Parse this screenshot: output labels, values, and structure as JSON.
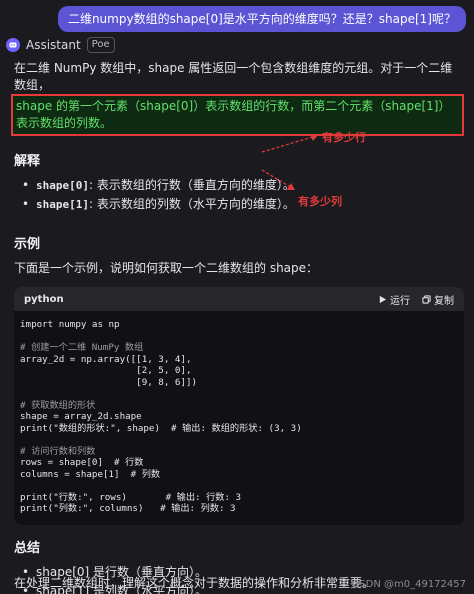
{
  "user_message": "二维numpy数组的shape[0]是水平方向的维度吗？还是？shape[1]呢？",
  "assistant": {
    "name": "Assistant",
    "badge": "Poe"
  },
  "intro_text": "在二维 NumPy 数组中，shape 属性返回一个包含数组维度的元组。对于一个二维数组，",
  "highlight_text": "shape 的第一个元素（shape[0]）表示数组的行数，而第二个元素（shape[1]）表示数组的列数。",
  "section1": {
    "title": "解释",
    "items": [
      {
        "code": "shape[0]",
        "text": ": 表示数组的行数（垂直方向的维度）。"
      },
      {
        "code": "shape[1]",
        "text": ": 表示数组的列数（水平方向的维度）。"
      }
    ]
  },
  "annotations": {
    "rows": "有多少行",
    "cols": "有多少列",
    "color": "#e23a3a"
  },
  "section2": {
    "title": "示例",
    "desc": "下面是一个示例，说明如何获取一个二维数组的 shape："
  },
  "code": {
    "lang": "python",
    "run_label": "运行",
    "copy_label": "复制",
    "lines": [
      "import numpy as np",
      "",
      "# 创建一个二维 NumPy 数组",
      "array_2d = np.array([[1, 3, 4],",
      "                     [2, 5, 0],",
      "                     [9, 8, 6]])",
      "",
      "# 获取数组的形状",
      "shape = array_2d.shape",
      "print(\"数组的形状:\", shape)  # 输出: 数组的形状: (3, 3)",
      "",
      "# 访问行数和列数",
      "rows = shape[0]  # 行数",
      "columns = shape[1]  # 列数",
      "",
      "print(\"行数:\", rows)       # 输出: 行数: 3",
      "print(\"列数:\", columns)   # 输出: 列数: 3"
    ]
  },
  "section3": {
    "title": "总结",
    "items": [
      {
        "code": "shape[0]",
        "text": " 是行数（垂直方向）。"
      },
      {
        "code": "shape[1]",
        "text": " 是列数（水平方向）。"
      }
    ]
  },
  "footer_text": "在处理二维数组时，理解这个概念对于数据的操作和分析非常重要。",
  "watermark": "CSDN @m0_49172457",
  "colors": {
    "accent": "#5b55d6",
    "highlight_border": "#e23a3a",
    "highlight_text": "#61e06a"
  },
  "icons": [
    "poe-avatar-icon",
    "play-icon",
    "copy-icon"
  ]
}
